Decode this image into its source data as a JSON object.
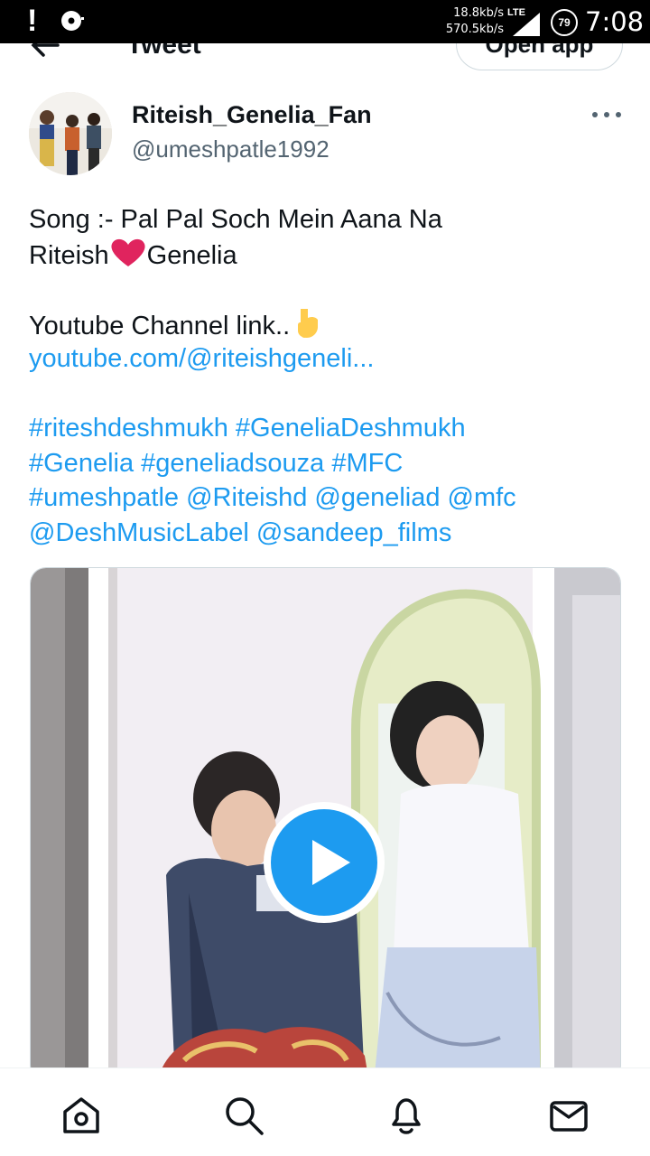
{
  "status_bar": {
    "speed_up": "18.8kb/s",
    "speed_down": "570.5kb/s",
    "network": "LTE",
    "battery": "79",
    "time": "7:08",
    "icons": [
      "alert-icon",
      "disc-icon",
      "signal-icon",
      "battery-icon"
    ]
  },
  "header": {
    "title": "Tweet",
    "open_app_label": "Open app"
  },
  "author": {
    "name": "Riteish_Genelia_Fan",
    "handle": "@umeshpatle1992"
  },
  "tweet": {
    "line1": "Song :- Pal Pal Soch Mein Aana Na",
    "line2_a": "Riteish",
    "line2_b": "Genelia",
    "line3": "Youtube Channel link..",
    "link": "youtube.com/@riteishgeneli...",
    "tags_line1": "#riteshdeshmukh #GeneliaDeshmukh",
    "tags_line2": "#Genelia #geneliadsouza #MFC",
    "tags_line3": "#umeshpatle @Riteishd @geneliad @mfc",
    "tags_line4": "@DeshMusicLabel @sandeep_films"
  },
  "colors": {
    "link": "#1d9bf0",
    "text": "#0f1419",
    "secondary": "#536471",
    "heart": "#e0245e"
  },
  "bottom_nav": [
    "home-icon",
    "search-icon",
    "notifications-icon",
    "messages-icon"
  ]
}
